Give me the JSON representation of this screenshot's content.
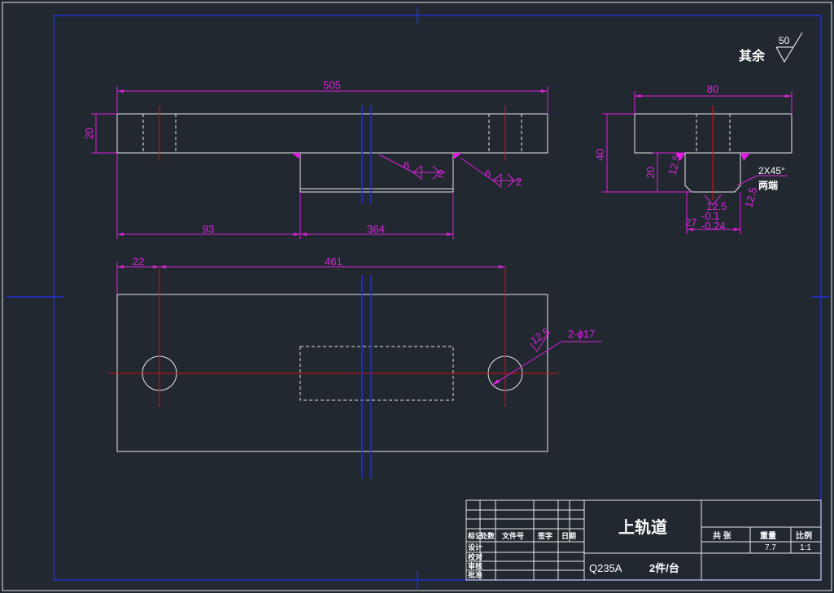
{
  "roughness": {
    "label": "其余",
    "value": "50"
  },
  "front_view": {
    "overall_length": "505",
    "height": "20",
    "left_offset": "93",
    "slot_length": "364",
    "weld_left": {
      "leg": "6",
      "count": "2"
    },
    "weld_right": {
      "leg": "6",
      "count": "2"
    }
  },
  "side_view": {
    "width": "80",
    "total_height": "40",
    "lower_height": "20",
    "chamfer": "2X45°",
    "chamfer_note": "两端",
    "roughness_a": "12.5",
    "roughness_b": "12.5",
    "roughness_c": "12.5",
    "tolerance_base": "27",
    "tolerance_upper": "-0.1",
    "tolerance_lower": "-0.24"
  },
  "plan_view": {
    "hole_offset": "22",
    "hole_spacing": "461",
    "hole_label": "2-ϕ17",
    "roughness": "12.5"
  },
  "title_block": {
    "part_name": "上轨道",
    "material": "Q235A",
    "quantity": "2件/台",
    "header_labels": [
      "标记",
      "处数",
      "文件号",
      "签字",
      "日期"
    ],
    "row_labels": [
      "设计",
      "校对",
      "审核",
      "批准"
    ],
    "info_headers": [
      "共  张",
      "重量",
      "比例"
    ],
    "weight": "7.7",
    "scale": "1:1"
  }
}
